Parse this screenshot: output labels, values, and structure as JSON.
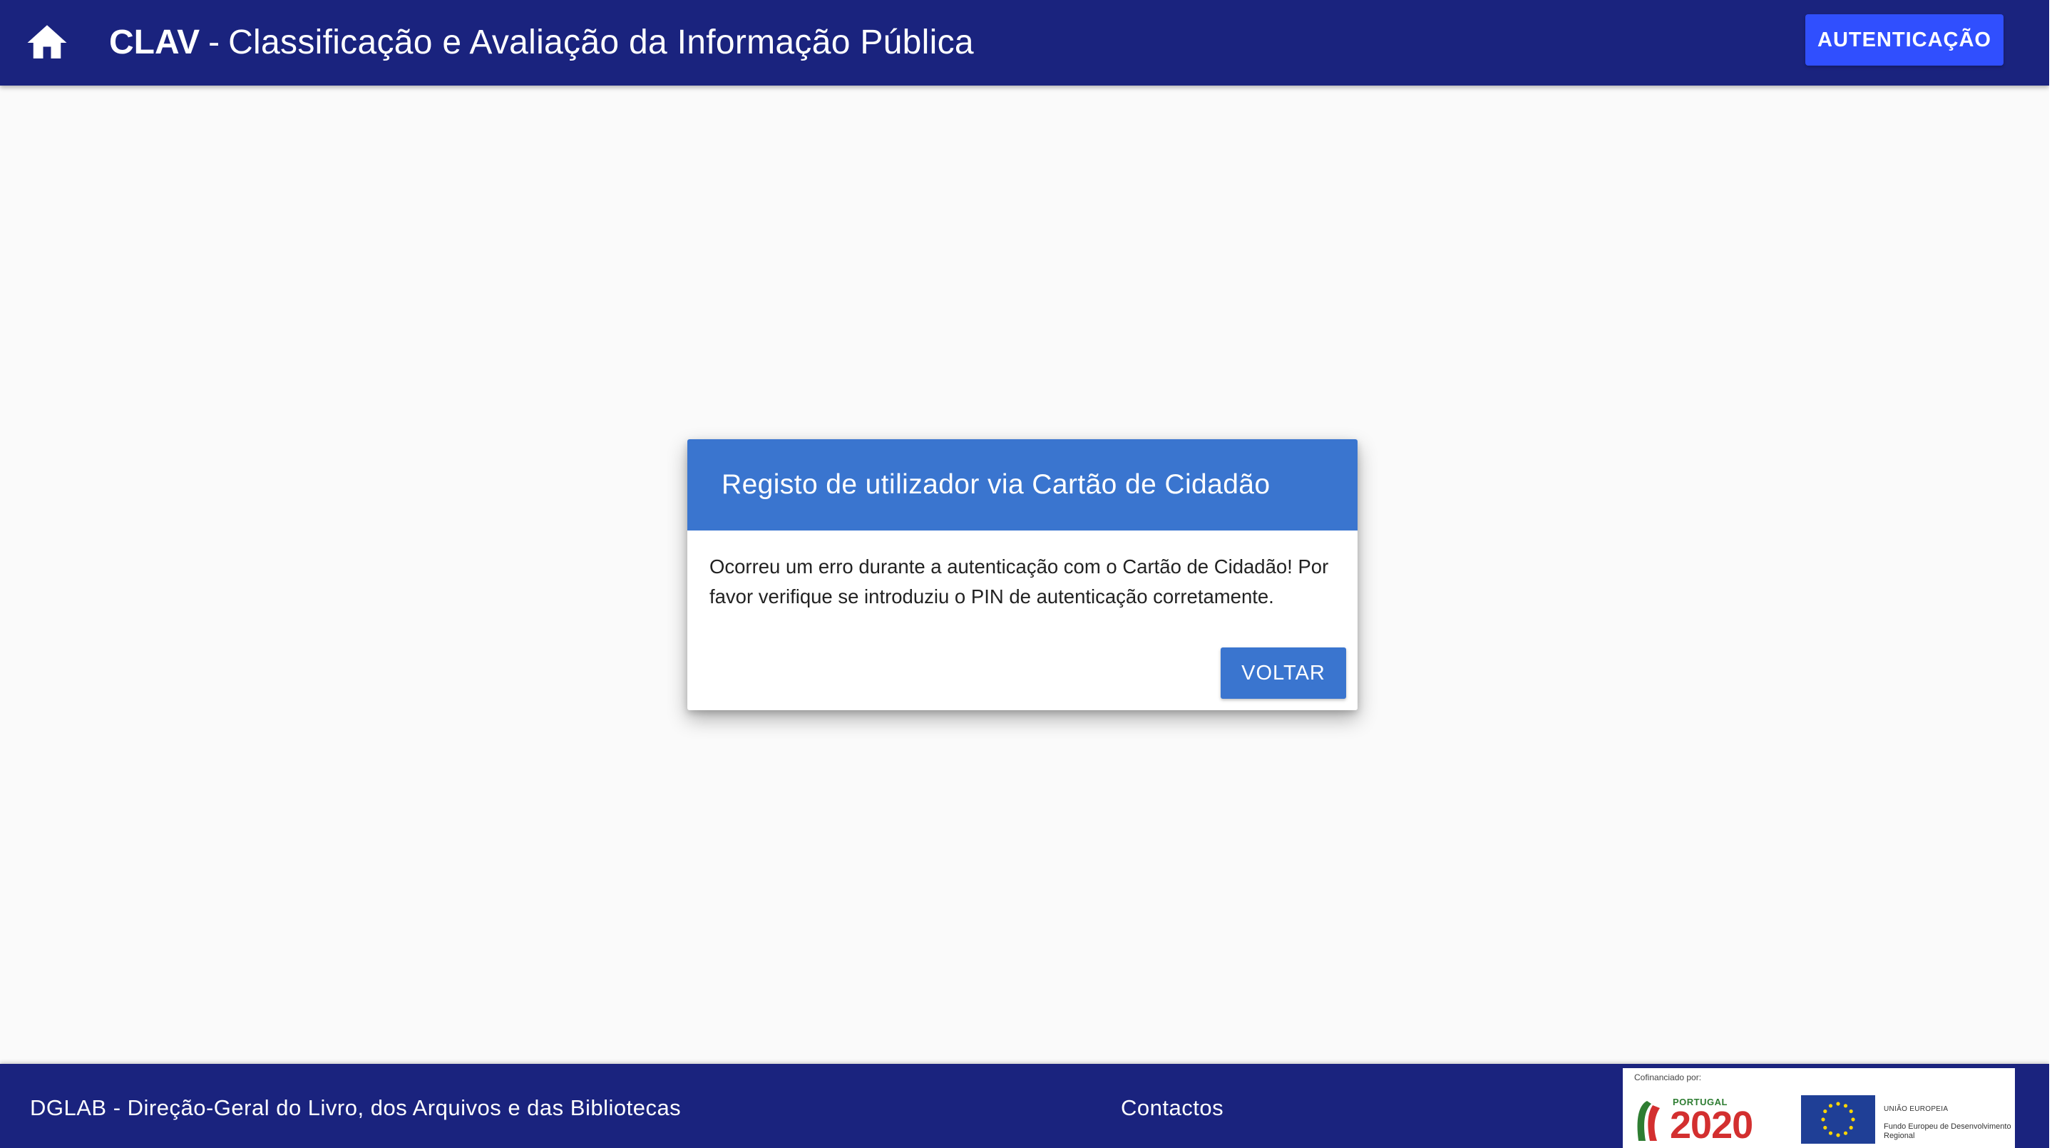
{
  "header": {
    "brand": "CLAV",
    "separator": "-",
    "full_title": "Classificação e Avaliação da Informação Pública",
    "auth_button_label": "AUTENTICAÇÃO",
    "home_icon": "home-icon"
  },
  "dialog": {
    "title": "Registo de utilizador via Cartão de Cidadão",
    "message": "Ocorreu um erro durante a autenticação com o Cartão de Cidadão! Por favor verifique se introduziu o PIN de autenticação corretamente.",
    "back_button_label": "VOLTAR"
  },
  "footer": {
    "organization": "DGLAB - Direção-Geral do Livro, dos Arquivos e das Bibliotecas",
    "contacts_label": "Contactos",
    "funding": {
      "caption": "Cofinanciado por:",
      "portugal_label": "PORTUGAL",
      "portugal_year": "2020",
      "eu_label": "UNIÃO EUROPEIA",
      "eu_fund": "Fundo Europeu de Desenvolvimento Regional"
    }
  },
  "colors": {
    "primary_bar": "#1a237e",
    "accent_button": "#304ffe",
    "dialog_header": "#3a75cf",
    "background": "#fafafa"
  }
}
